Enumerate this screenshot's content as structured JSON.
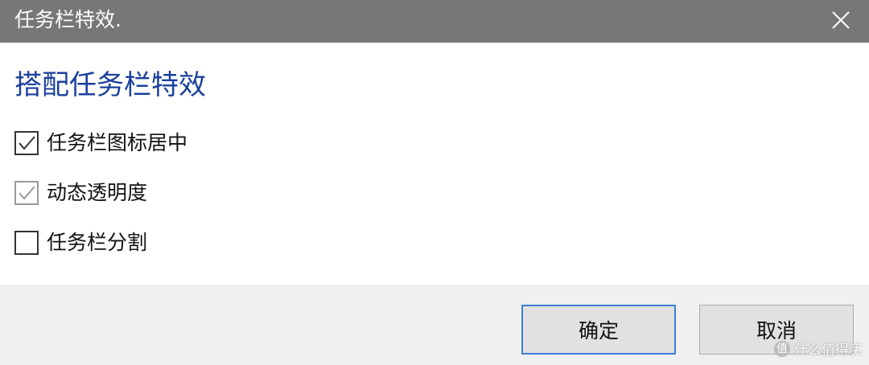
{
  "window": {
    "title": "任务栏特效.",
    "close_icon": "close-icon"
  },
  "content": {
    "heading": "搭配任务栏特效",
    "options": [
      {
        "label": "任务栏图标居中",
        "checked": true,
        "enabled": true
      },
      {
        "label": "动态透明度",
        "checked": true,
        "enabled": false
      },
      {
        "label": "任务栏分割",
        "checked": false,
        "enabled": true
      }
    ]
  },
  "footer": {
    "ok_label": "确定",
    "cancel_label": "取消"
  },
  "watermark": {
    "badge": "值",
    "text": "什么值得买"
  },
  "colors": {
    "titlebar": "#777777",
    "heading": "#1a3f9c",
    "focus_border": "#3c7fd8",
    "footer_bg": "#f0f0f0"
  }
}
